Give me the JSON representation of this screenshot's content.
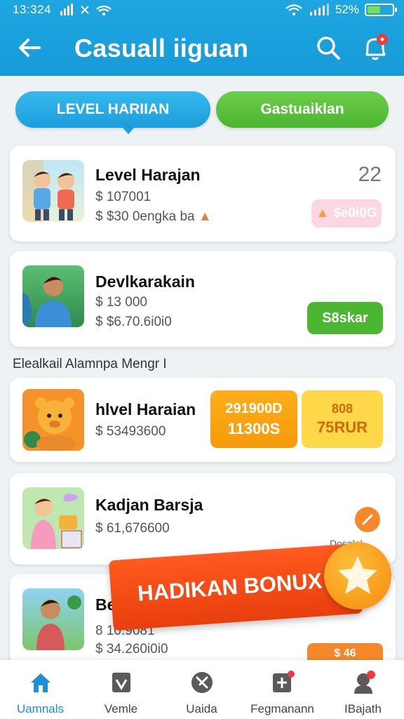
{
  "status_bar": {
    "time": "13:324",
    "battery": "52%",
    "battery_level": 0.52
  },
  "app_bar": {
    "title": "Casuall iiguan"
  },
  "tabs": [
    {
      "label": "LEVEL HARIIAN",
      "active": true
    },
    {
      "label": "Gastuaiklan",
      "active": false
    }
  ],
  "cards": [
    {
      "title": "Level Harajan",
      "line1": "$ 107001",
      "line2": "$ $30 0engka ba",
      "count": "22",
      "badge": "$e0i0G"
    },
    {
      "title": "Devlkarakain",
      "line1": "$ 13 000",
      "line2": "$ $6.70.6i0i0",
      "button": "S8skar"
    }
  ],
  "section_label": "Elealkail Alamnpa Mengr I",
  "cards2": [
    {
      "title": "hlvel Haraian",
      "line1": "$ 53493600",
      "box1_top": "291900D",
      "box1_bottom": "11300S",
      "box2_top": "808",
      "box2_bottom": "75RUR"
    },
    {
      "title": "Kadjan Barsja",
      "line1": "$ 61,676600",
      "tag": "Dosalal"
    },
    {
      "title": "Be",
      "line1": "8 10.9081",
      "line2": "$ 34.260i0i0",
      "badge": "$ 46"
    }
  ],
  "bonus": {
    "label": "HADIKAN BONUX"
  },
  "bottom_nav": [
    {
      "label": "Uamnals",
      "icon": "home-icon",
      "active": true
    },
    {
      "label": "Vemle",
      "icon": "shield-icon",
      "active": false
    },
    {
      "label": "Uaida",
      "icon": "tools-icon",
      "active": false
    },
    {
      "label": "Fegmanann",
      "icon": "plus-square-icon",
      "active": false
    },
    {
      "label": "IBajath",
      "icon": "user-bell-icon",
      "active": false
    }
  ],
  "colors": {
    "primary": "#1fa6e0",
    "green": "#4cb531",
    "orange": "#f59a0a",
    "yellow": "#ffd84a",
    "red_orange": "#e93e0e"
  }
}
